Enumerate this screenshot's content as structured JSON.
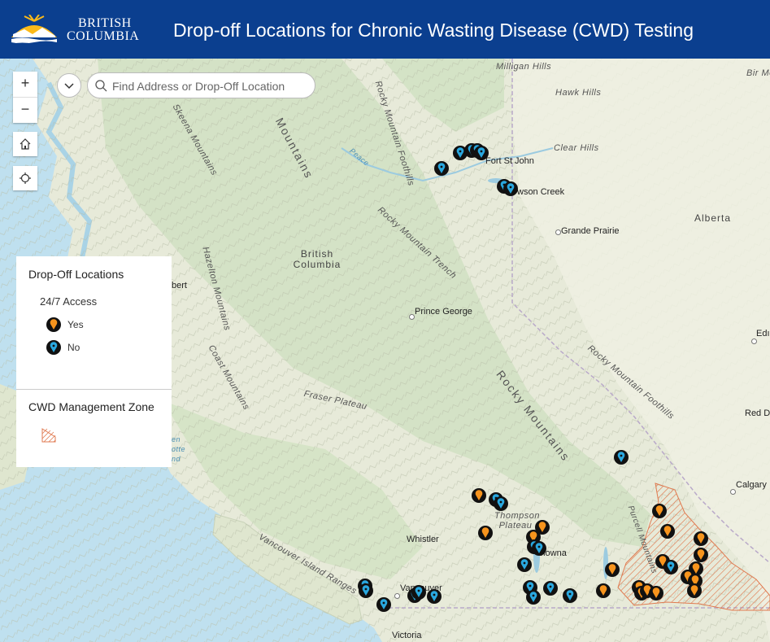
{
  "header": {
    "logo_line1": "BRITISH",
    "logo_line2": "COLUMBIA",
    "title": "Drop-off Locations for Chronic Wasting Disease (CWD) Testing"
  },
  "search": {
    "placeholder": "Find Address or Drop-Off Location"
  },
  "controls": {
    "zoom_in": "+",
    "zoom_out": "−",
    "home_icon": "home-icon",
    "locate_icon": "locate-icon",
    "collapse_icon": "chevron-down-icon",
    "search_icon": "search-icon"
  },
  "legend": {
    "dropoff_title": "Drop-Off Locations",
    "access_label": "24/7 Access",
    "yes_label": "Yes",
    "no_label": "No",
    "zone_title": "CWD Management Zone"
  },
  "colors": {
    "header": "#0b3f8f",
    "pin_yes": "#f7941d",
    "pin_no": "#29a8e0",
    "pin_border": "#111111",
    "zone_hatch": "#e07a50"
  },
  "map_labels": {
    "milligan_hills": "Milligan Hills",
    "hawk_hills": "Hawk Hills",
    "clear_hills": "Clear Hills",
    "birch_mountains": "Bir Moun",
    "fort_st_john": "Fort St John",
    "dawson_creek": "wson Creek",
    "grande_prairie": "Grande Prairie",
    "alberta": "Alberta",
    "british_columbia": "British Columbia",
    "prince_george": "Prince George",
    "edmonton": "Edı",
    "red_deer": "Red De",
    "calgary": "Calgary",
    "whistler": "Whistler",
    "vancouver": "Vancouver",
    "victoria": "Victoria",
    "kelowna": "elowna",
    "thompson_plateau": "Thompson Plateau",
    "fraser_plateau": "Fraser Plateau",
    "rocky_mountains_north": "Mountains",
    "rocky_mountains": "Rocky Mountains",
    "rocky_mountain_foothills_n": "Rocky Mountain Foothills",
    "rocky_mountain_trench": "Rocky Mountain Trench",
    "rocky_mountain_foothills_s": "Rocky Mountain Foothills",
    "skeena_mountains": "Skeena Mountains",
    "hazelton_mountains": "Hazelton Mountains",
    "coast_mountains": "Coast Mountains",
    "vancouver_island_ranges": "Vancouver Island Ranges",
    "purcell_mountains": "Purcell Mountains",
    "peace": "Peace",
    "bert": "bert",
    "queen_charlotte": "en otte nd"
  }
}
